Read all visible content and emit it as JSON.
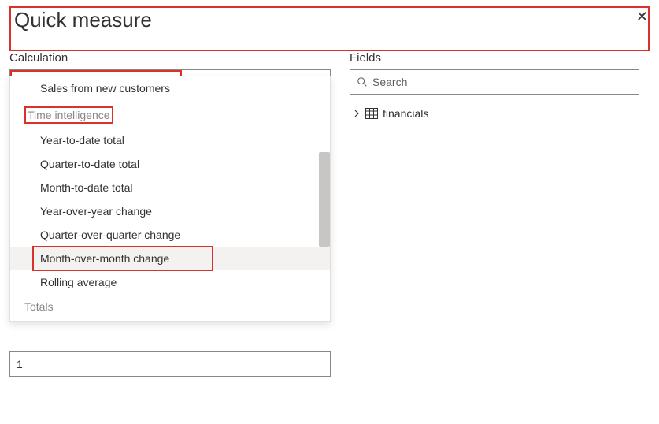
{
  "dialog": {
    "title": "Quick measure"
  },
  "calculation": {
    "label": "Calculation",
    "selected": "Month-over-month change",
    "items": {
      "sales_new": "Sales from new customers",
      "ytd": "Year-to-date total",
      "qtd": "Quarter-to-date total",
      "mtd": "Month-to-date total",
      "yoy": "Year-over-year change",
      "qoq": "Quarter-over-quarter change",
      "mom": "Month-over-month change",
      "rolling": "Rolling average"
    },
    "groups": {
      "time_intel": "Time intelligence",
      "totals": "Totals"
    }
  },
  "numeric": {
    "value": "1"
  },
  "fields": {
    "label": "Fields",
    "search_placeholder": "Search",
    "tables": {
      "financials": "financials"
    }
  }
}
